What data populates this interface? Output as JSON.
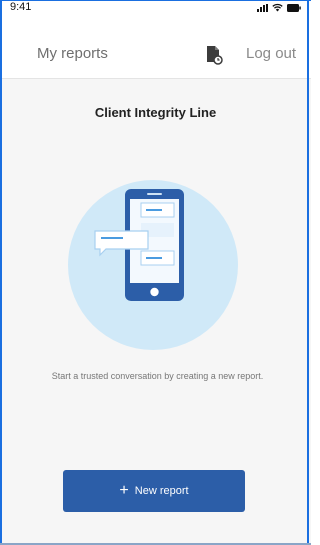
{
  "status_bar": {
    "time": "9:41",
    "icons": [
      "signal-icon",
      "wifi-icon",
      "battery-icon"
    ]
  },
  "header": {
    "title": "My reports",
    "doc_icon": "document-clock-icon",
    "logout_label": "Log out"
  },
  "main": {
    "title": "Client Integrity Line",
    "illustration": "phone-chat-illustration",
    "message": "Start a trusted conversation by creating a new report.",
    "new_report_label": "New report",
    "new_report_icon": "plus-icon"
  },
  "colors": {
    "accent": "#2c5ea8",
    "illustration_bg": "#d0e9f8",
    "page_bg": "#f6f6f6",
    "frame": "#1a6fe0"
  }
}
